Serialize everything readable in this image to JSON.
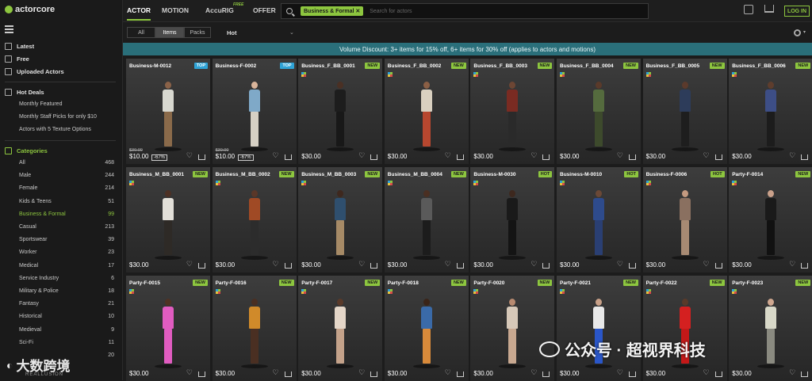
{
  "app": {
    "logo": "actorcore"
  },
  "sidebar": {
    "main": [
      {
        "label": "Latest",
        "icon": "new-icon"
      },
      {
        "label": "Free",
        "icon": "gift-icon"
      },
      {
        "label": "Uploaded Actors",
        "icon": "upload-icon"
      }
    ],
    "hot_deals": {
      "label": "Hot Deals",
      "icon": "tag-icon",
      "items": [
        "Monthly Featured",
        "Monthly Staff Picks for only $10",
        "Actors with 5 Texture Options"
      ]
    },
    "categories": {
      "label": "Categories",
      "items": [
        {
          "label": "All",
          "count": "468"
        },
        {
          "label": "Male",
          "count": "244"
        },
        {
          "label": "Female",
          "count": "214"
        },
        {
          "label": "Kids & Teens",
          "count": "51"
        },
        {
          "label": "Business & Formal",
          "count": "99",
          "active": true
        },
        {
          "label": "Casual",
          "count": "213"
        },
        {
          "label": "Sportswear",
          "count": "39"
        },
        {
          "label": "Worker",
          "count": "23"
        },
        {
          "label": "Medical",
          "count": "17"
        },
        {
          "label": "Service Industry",
          "count": "6"
        },
        {
          "label": "Military & Police",
          "count": "18"
        },
        {
          "label": "Fantasy",
          "count": "21"
        },
        {
          "label": "Historical",
          "count": "10"
        },
        {
          "label": "Medieval",
          "count": "9"
        },
        {
          "label": "Sci-Fi",
          "count": "11"
        },
        {
          "label": "",
          "count": "20"
        }
      ]
    },
    "watermark": {
      "text": "大数跨境",
      "sub": "REALLUSION"
    }
  },
  "topbar": {
    "tabs": [
      "ACTOR",
      "MOTION",
      "AccuRIG",
      "OFFER"
    ],
    "free_tag": "FREE",
    "search_chip": "Business & Formal ✕",
    "search_placeholder": "Search for actors",
    "login": "LOG IN"
  },
  "filter": {
    "segments": [
      "All",
      "Items",
      "Packs"
    ],
    "active": "Items",
    "sort": "Hot",
    "sort_chevron": "⌄"
  },
  "banner": "Volume Discount: 3+ items for 15% off, 6+ items for 30% off (applies to actors and motions)",
  "cards": [
    {
      "name": "Business-M-0012",
      "badge": "TOP",
      "price": "$10.00",
      "old": "$30.00",
      "disc": "-67%",
      "skin": "#8a6248",
      "top": "#d8d8d0",
      "bottom": "#8a6a4a"
    },
    {
      "name": "Business-F-0002",
      "badge": "TOP",
      "price": "$10.00",
      "old": "$30.00",
      "disc": "-67%",
      "skin": "#d9b49a",
      "top": "#7fa9c8",
      "bottom": "#d6d0c4"
    },
    {
      "name": "Business_F_BB_0001",
      "badge": "NEW",
      "price": "$30.00",
      "skin": "#4a3024",
      "top": "#1d1d1d",
      "bottom": "#181818"
    },
    {
      "name": "Business_F_BB_0002",
      "badge": "NEW",
      "price": "$30.00",
      "skin": "#8b5f45",
      "top": "#d9d0c0",
      "bottom": "#b7472f"
    },
    {
      "name": "Business_F_BB_0003",
      "badge": "NEW",
      "price": "$30.00",
      "skin": "#6d4634",
      "top": "#7a2b22",
      "bottom": "#2a2a2a"
    },
    {
      "name": "Business_F_BB_0004",
      "badge": "NEW",
      "price": "$30.00",
      "skin": "#5a3a2a",
      "top": "#556b3e",
      "bottom": "#3d4a2c"
    },
    {
      "name": "Business_F_BB_0005",
      "badge": "NEW",
      "price": "$30.00",
      "skin": "#5b3a2c",
      "top": "#2d3c5a",
      "bottom": "#1e1e1e"
    },
    {
      "name": "Business_F_BB_0006",
      "badge": "NEW",
      "price": "$30.00",
      "skin": "#5e3d2d",
      "top": "#3d4e86",
      "bottom": "#1c1c1c"
    },
    {
      "name": "Business_M_BB_0001",
      "badge": "NEW",
      "price": "$30.00",
      "skin": "#4c3024",
      "top": "#e2dfd8",
      "bottom": "#2e2a26"
    },
    {
      "name": "Business_M_BB_0002",
      "badge": "NEW",
      "price": "$30.00",
      "skin": "#5a3728",
      "top": "#a04a25",
      "bottom": "#2c2c2c"
    },
    {
      "name": "Business_M_BB_0003",
      "badge": "NEW",
      "price": "$30.00",
      "skin": "#3e281e",
      "top": "#2f4f6e",
      "bottom": "#a68a66"
    },
    {
      "name": "Business_M_BB_0004",
      "badge": "NEW",
      "price": "$30.00",
      "skin": "#4a2f22",
      "top": "#5a5a5a",
      "bottom": "#1c1c1c"
    },
    {
      "name": "Business-M-0030",
      "badge": "HOT",
      "price": "$30.00",
      "skin": "#3d281e",
      "top": "#1a1a1a",
      "bottom": "#141414"
    },
    {
      "name": "Business-M-0010",
      "badge": "HOT",
      "price": "$30.00",
      "skin": "#6b4836",
      "top": "#2e4b8c",
      "bottom": "#2a3f73"
    },
    {
      "name": "Business-F-0006",
      "badge": "HOT",
      "price": "$30.00",
      "skin": "#c49a80",
      "top": "#8a7060",
      "bottom": "#a78a73"
    },
    {
      "name": "Party-F-0014",
      "badge": "NEW",
      "price": "$30.00",
      "skin": "#c9a08a",
      "top": "#1a1a1a",
      "bottom": "#111111"
    },
    {
      "name": "Party-F-0015",
      "badge": "NEW",
      "price": "$30.00",
      "skin": "#4e3224",
      "top": "#e05cc0",
      "bottom": "#e05cc0"
    },
    {
      "name": "Party-F-0016",
      "badge": "NEW",
      "price": "$30.00",
      "skin": "#4a2f22",
      "top": "#d08a2a",
      "bottom": "#4a2f22"
    },
    {
      "name": "Party-F-0017",
      "badge": "NEW",
      "price": "$30.00",
      "skin": "#5a3a2a",
      "top": "#e4d6c8",
      "bottom": "#c4a28a"
    },
    {
      "name": "Party-F-0018",
      "badge": "NEW",
      "price": "$30.00",
      "skin": "#3a2418",
      "top": "#3a6aa8",
      "bottom": "#d88a3a"
    },
    {
      "name": "Party-F-0020",
      "badge": "NEW",
      "price": "$30.00",
      "skin": "#b88a70",
      "top": "#d6c8b8",
      "bottom": "#c8a890"
    },
    {
      "name": "Party-F-0021",
      "badge": "NEW",
      "price": "$30.00",
      "skin": "#c8a088",
      "top": "#e8e8e8",
      "bottom": "#2a56c8"
    },
    {
      "name": "Party-F-0022",
      "badge": "NEW",
      "price": "$30.00",
      "skin": "#5a3a2a",
      "top": "#d42020",
      "bottom": "#c41818"
    },
    {
      "name": "Party-F-0023",
      "badge": "NEW",
      "price": "$30.00",
      "skin": "#d0a890",
      "top": "#d8d8c8",
      "bottom": "#8a8a80"
    }
  ],
  "watermark_right": "公众号 · 超视界科技",
  "colors": {
    "accent": "#8dc63f",
    "banner": "#2a6f7a",
    "top_badge": "#2fa3d6"
  }
}
